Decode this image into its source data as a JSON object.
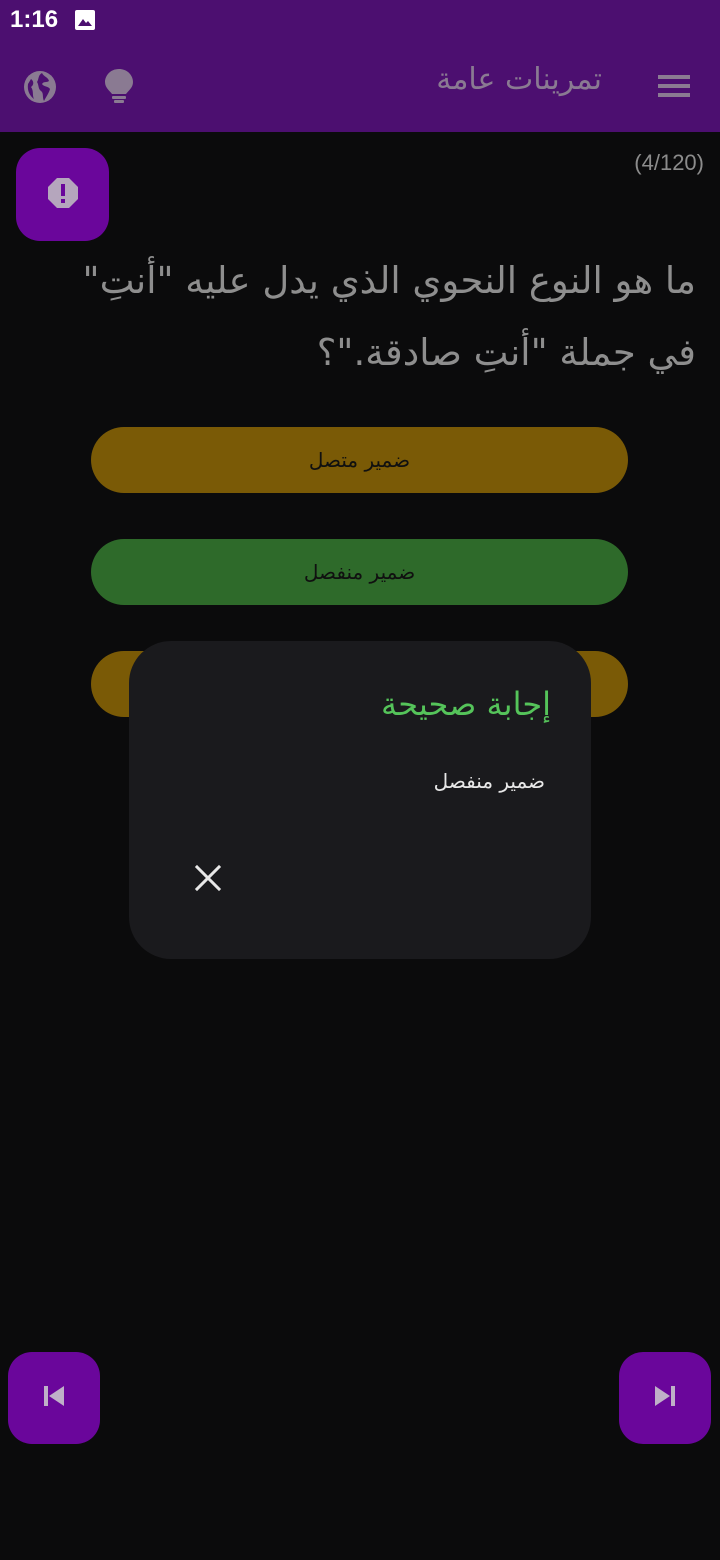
{
  "status_bar": {
    "time": "1:16",
    "icons": [
      "image-icon"
    ]
  },
  "app_bar": {
    "title": "تمرينات عامة",
    "icons": [
      "globe-icon",
      "lightbulb-icon",
      "menu-icon"
    ]
  },
  "quiz": {
    "counter": "(4/120)",
    "report_icon": "alert-octagon-icon",
    "question": "ما هو النوع النحوي الذي يدل عليه \"أنتِ\" في جملة \"أنتِ صادقة.\"؟",
    "answers": [
      {
        "label": "ضمير متصل",
        "color": "#7a5a06"
      },
      {
        "label": "ضمير منفصل",
        "color": "#2e6a2a"
      },
      {
        "label": "",
        "color": "#7a5a06"
      }
    ]
  },
  "dialog": {
    "title": "إجابة صحيحة",
    "message": "ضمير منفصل",
    "close_icon": "close-icon"
  },
  "navigation": {
    "prev_icon": "skip-previous-icon",
    "next_icon": "skip-next-icon"
  },
  "colors": {
    "primary": "#4c0f70",
    "accent_button": "#6a069b",
    "background": "#0b0b0c",
    "dialog_background": "#1a1a1d",
    "correct_text": "#55c45a"
  }
}
